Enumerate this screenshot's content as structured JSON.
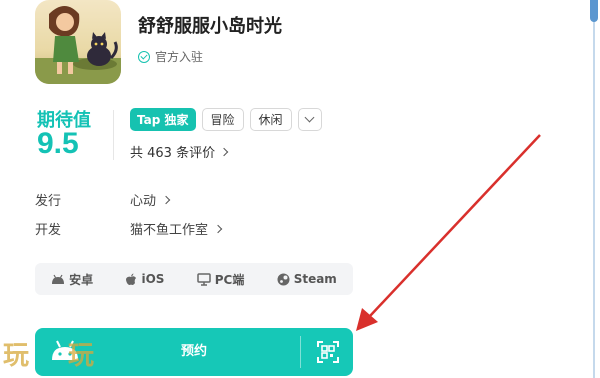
{
  "app": {
    "title": "舒舒服服小岛时光",
    "official_label": "官方入驻",
    "icon_name": "game-cover-girl-cat-icon"
  },
  "rating": {
    "label": "期待值",
    "value": "9.5",
    "reviews": "共 463 条评价"
  },
  "tags": {
    "tap_tag": "Tap 独家",
    "items": [
      "冒险",
      "休闲"
    ]
  },
  "info": {
    "publisher_label": "发行",
    "publisher_value": "心动",
    "developer_label": "开发",
    "developer_value": "猫不鱼工作室"
  },
  "platforms": [
    "安卓",
    "iOS",
    "PC端",
    "Steam"
  ],
  "reserve": {
    "label": "预约"
  },
  "watermark": [
    "玩",
    "玩"
  ],
  "colors": {
    "accent": "#16c2b0",
    "arrow": "#d9302c",
    "scrollbar": "#5b97d0"
  }
}
